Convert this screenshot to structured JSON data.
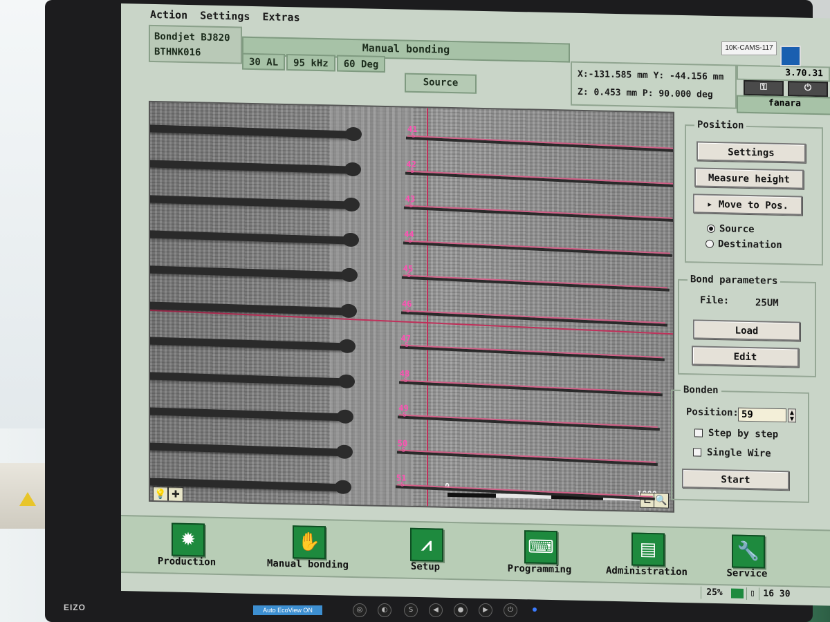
{
  "menu": [
    "Action",
    "Settings",
    "Extras"
  ],
  "header": {
    "machine": "Bondjet BJ820",
    "serial": "BTHNK016",
    "mode_title": "Manual bonding",
    "params": [
      "30 AL",
      "95 kHz",
      "60 Deg"
    ],
    "source_tab": "Source",
    "coords_line1": "X:-131.585 mm  Y: -44.156 mm",
    "coords_line2": "Z:   0.453 mm  P:  90.000 deg",
    "version": "3.70.31",
    "user": "fanara"
  },
  "asset_tag": "10K-CAMS-117",
  "camera": {
    "wire_labels": [
      "41",
      "42",
      "43",
      "44",
      "45",
      "46",
      "47",
      "48",
      "49",
      "50",
      "51"
    ],
    "s_label": "S",
    "scale_start": "0",
    "scale_end": "1000"
  },
  "position_group": {
    "title": "Position",
    "settings": "Settings",
    "measure_height": "Measure height",
    "move_to_pos": "▸ Move to Pos.",
    "radio_source": "Source",
    "radio_destination": "Destination"
  },
  "bond_params": {
    "title": "Bond parameters",
    "file_label": "File:",
    "file_value": "25UM",
    "load": "Load",
    "edit": "Edit"
  },
  "bonden": {
    "title": "Bonden",
    "position_label": "Position:",
    "position_value": "59",
    "step_by_step": "Step by step",
    "single_wire": "Single Wire",
    "start": "Start"
  },
  "nav": [
    {
      "label": "Production",
      "icon": "gear-icon"
    },
    {
      "label": "Manual bonding",
      "icon": "hand-icon"
    },
    {
      "label": "Setup",
      "icon": "compass-icon"
    },
    {
      "label": "Programming",
      "icon": "keyboard-icon"
    },
    {
      "label": "Administration",
      "icon": "document-user-icon"
    },
    {
      "label": "Service",
      "icon": "wrench-icon"
    }
  ],
  "status": {
    "zoom": "25%",
    "time": "16 30"
  },
  "monitor": {
    "brand": "EIZO",
    "eco": "Auto EcoView ON"
  },
  "colors": {
    "accent_green": "#1e8a3e",
    "panel_green": "#c9d5c8",
    "wire_label": "#ff4fb3"
  }
}
